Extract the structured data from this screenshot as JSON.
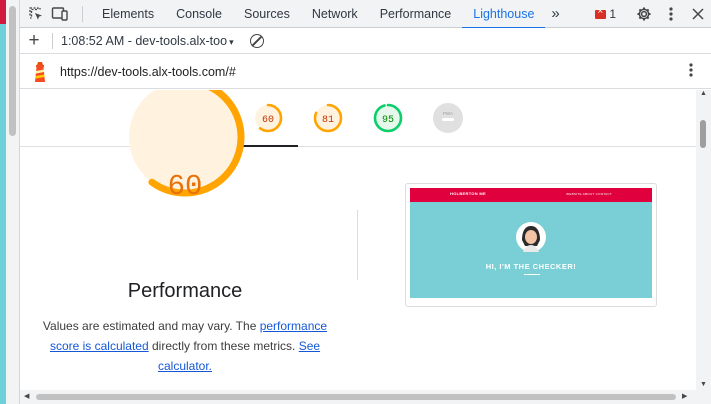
{
  "devtools": {
    "tabs": [
      "Elements",
      "Console",
      "Sources",
      "Network",
      "Performance",
      "Lighthouse"
    ],
    "active_tab": "Lighthouse",
    "more_tabs_glyph": "»",
    "error_count": "1",
    "icons": [
      "inspect-element-icon",
      "device-toolbar-icon",
      "settings-gear-icon",
      "more-vert-icon",
      "close-icon"
    ]
  },
  "toolbar": {
    "add_glyph": "+",
    "report_label": "1:08:52 AM - dev-tools.alx-too",
    "caret": "▾"
  },
  "urlbar": {
    "url": "https://dev-tools.alx-tools.com/#"
  },
  "gauges": [
    {
      "score": "60",
      "color": "#ffa400",
      "bg": "#fff3e0",
      "text_color": "#c33300"
    },
    {
      "score": "81",
      "color": "#ffa400",
      "bg": "#fff3e0",
      "text_color": "#c33300"
    },
    {
      "score": "95",
      "color": "#0cce6b",
      "bg": "#e6f7ec",
      "text_color": "#008800"
    },
    {
      "score": "PWA",
      "color": "#cccccc",
      "bg": "#e8e8e8",
      "text_color": "#9e9e9e"
    }
  ],
  "performance": {
    "score": "60",
    "score_fraction": 0.6,
    "title": "Performance",
    "desc_prefix": "Values are estimated and may vary. The ",
    "link_score": "performance score is calculated",
    "desc_middle": " directly from these metrics. ",
    "link_calc": "See calculator."
  },
  "screenshot": {
    "brand": "HOLBERTON ME",
    "nav": "WEBSITE  ABOUT  CONTACT",
    "headline": "HI, I'M THE CHECKER!"
  },
  "colors": {
    "accent": "#1a73e8",
    "average": "#ffa400",
    "pass": "#0cce6b",
    "page_header": "#e1003e",
    "page_body": "#79cfd5"
  }
}
